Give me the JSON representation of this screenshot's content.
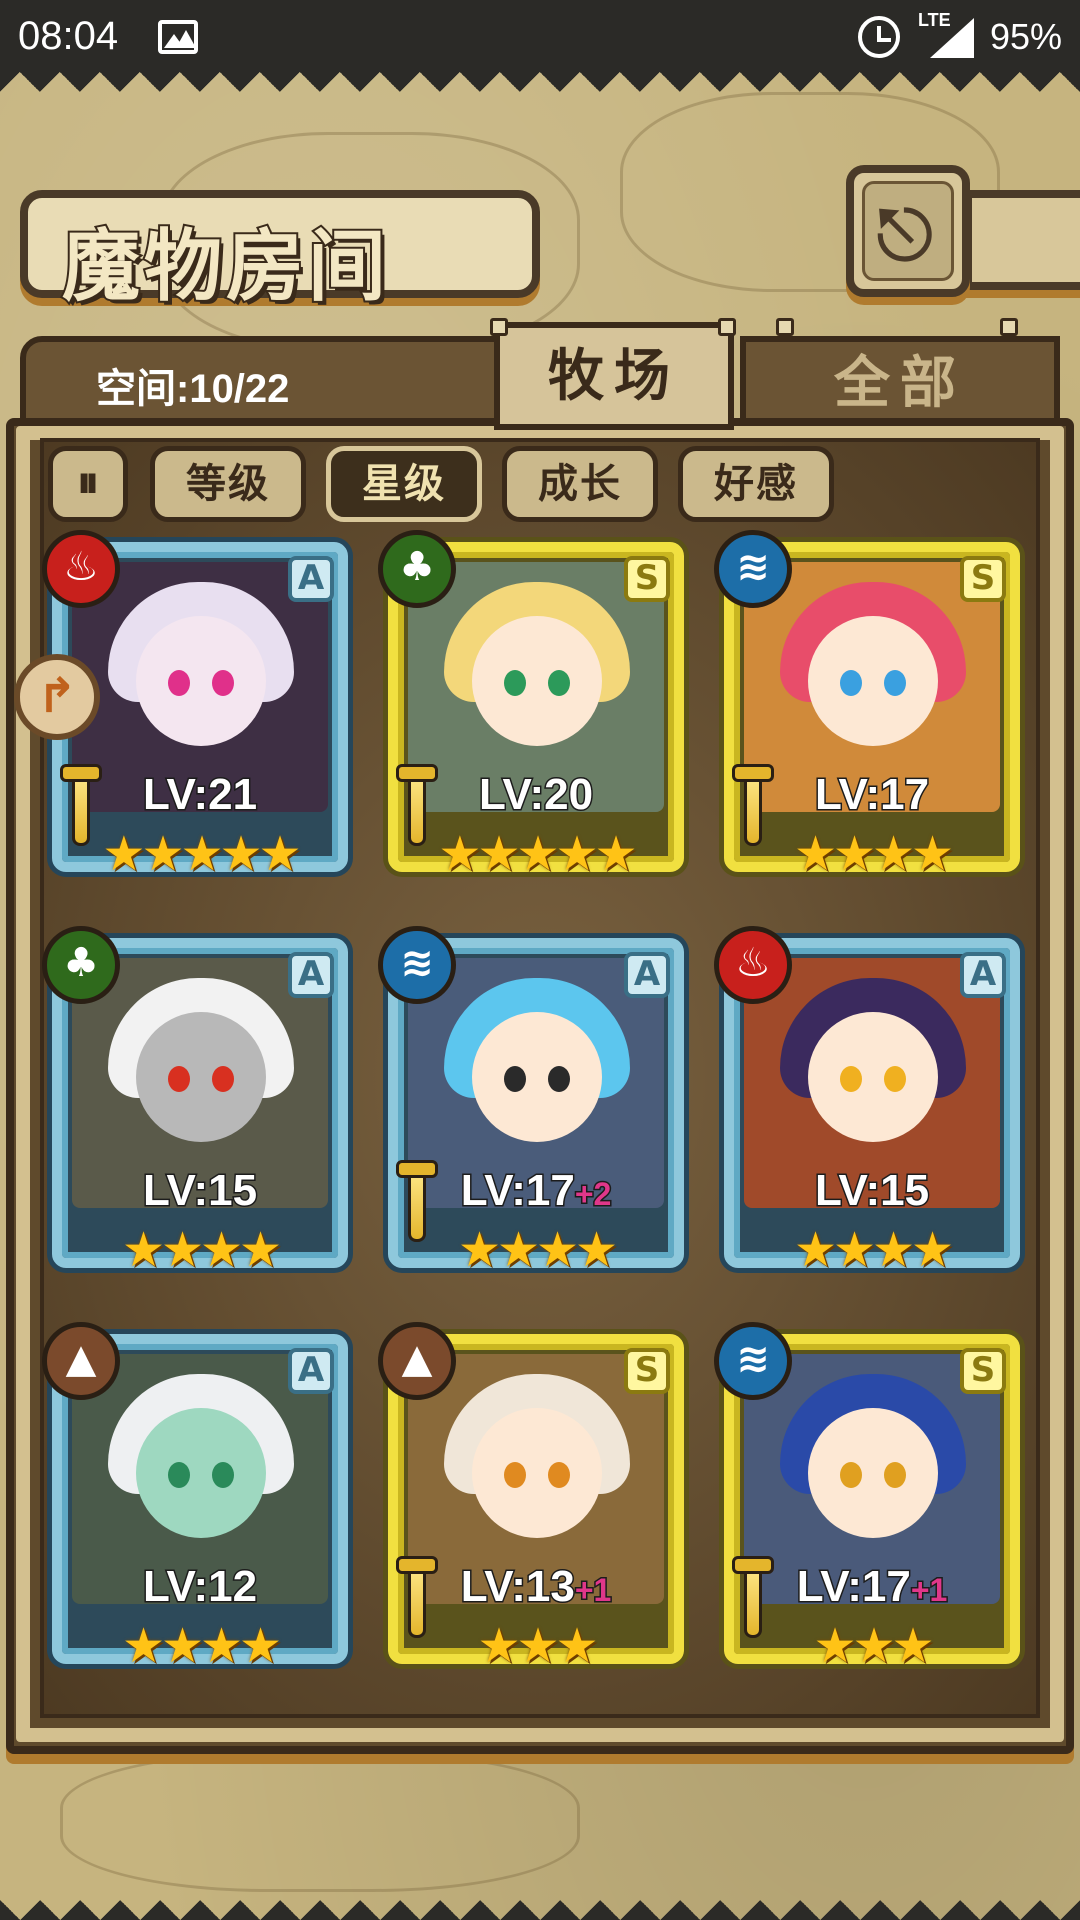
{
  "status_bar": {
    "time": "08:04",
    "network": "LTE",
    "battery": "95%",
    "icons": [
      "image-icon",
      "alarm-icon",
      "signal-icon"
    ]
  },
  "header": {
    "title": "魔物房间",
    "back_icon": "return-arrow-icon",
    "back_glyph": "⎋"
  },
  "space": {
    "label": "空间:10/22"
  },
  "tabs": [
    {
      "label": "牧场",
      "active": true
    },
    {
      "label": "全部",
      "active": false
    }
  ],
  "sort": {
    "toggle_glyph": "⏸",
    "buttons": [
      {
        "label": "等级",
        "active": false
      },
      {
        "label": "星级",
        "active": true
      },
      {
        "label": "成长",
        "active": false
      },
      {
        "label": "好感",
        "active": false
      }
    ]
  },
  "side_arrow": {
    "glyph": "↱"
  },
  "monsters": [
    {
      "element": "fire",
      "rank": "A",
      "level": "LV:21",
      "plus": "",
      "stars": 5,
      "sword": true,
      "hair": "#e8dff0",
      "skin": "#f4e6f0",
      "eye": "#e0308a",
      "bg": "#3e2f44"
    },
    {
      "element": "wood",
      "rank": "S",
      "level": "LV:20",
      "plus": "",
      "stars": 5,
      "sword": true,
      "hair": "#f3d77a",
      "skin": "#fde8d4",
      "eye": "#2c9a5a",
      "bg": "#6a7e66"
    },
    {
      "element": "water",
      "rank": "S",
      "level": "LV:17",
      "plus": "",
      "stars": 4,
      "sword": true,
      "hair": "#e84d6a",
      "skin": "#fde8d4",
      "eye": "#3aa0e0",
      "bg": "#d08a3a"
    },
    {
      "element": "wood",
      "rank": "A",
      "level": "LV:15",
      "plus": "",
      "stars": 4,
      "sword": false,
      "hair": "#f2f2f2",
      "skin": "#b8b8b8",
      "eye": "#d83020",
      "bg": "#5a5a4a"
    },
    {
      "element": "water",
      "rank": "A",
      "level": "LV:17",
      "plus": "+2",
      "stars": 4,
      "sword": true,
      "hair": "#5cc6ee",
      "skin": "#fde8d4",
      "eye": "#2a2a2a",
      "bg": "#4a5c7a"
    },
    {
      "element": "fire",
      "rank": "A",
      "level": "LV:15",
      "plus": "",
      "stars": 4,
      "sword": false,
      "hair": "#3b2a5e",
      "skin": "#fde8d4",
      "eye": "#f0b020",
      "bg": "#a04a2a"
    },
    {
      "element": "earth",
      "rank": "A",
      "level": "LV:12",
      "plus": "",
      "stars": 4,
      "sword": false,
      "hair": "#eef0f2",
      "skin": "#9ed8c0",
      "eye": "#2a8a5a",
      "bg": "#4a5a4a"
    },
    {
      "element": "earth",
      "rank": "S",
      "level": "LV:13",
      "plus": "+1",
      "stars": 3,
      "sword": true,
      "hair": "#f0e6d8",
      "skin": "#fde8d4",
      "eye": "#e08a20",
      "bg": "#8a6a3a"
    },
    {
      "element": "water",
      "rank": "S",
      "level": "LV:17",
      "plus": "+1",
      "stars": 3,
      "sword": true,
      "hair": "#2a4aa8",
      "skin": "#fde8d4",
      "eye": "#e0a020",
      "bg": "#4a5a7a"
    }
  ],
  "element_glyphs": {
    "fire": "♨",
    "wood": "♣",
    "water": "≋",
    "earth": "▲"
  },
  "star_glyph": "★"
}
